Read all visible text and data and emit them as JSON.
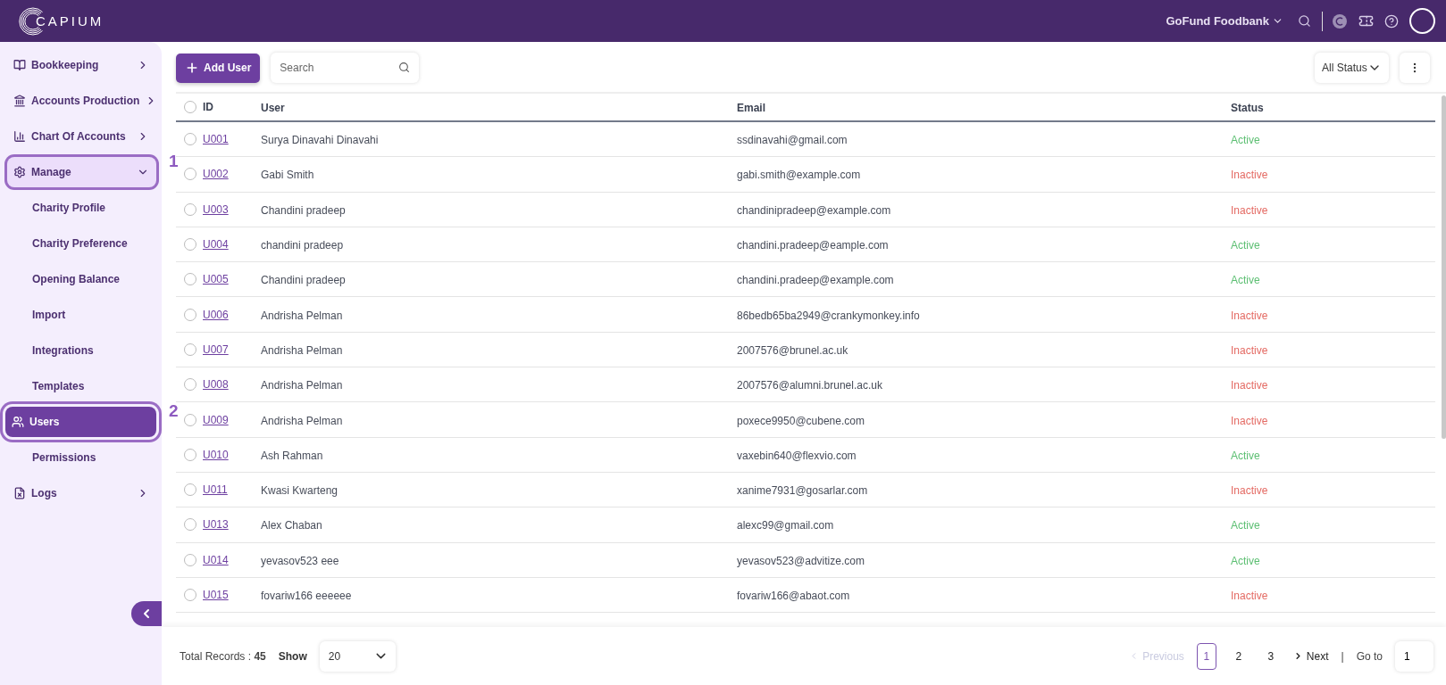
{
  "header": {
    "logo": "CAPIUM",
    "organisation": "GoFund Foodbank"
  },
  "sidebar": {
    "items": [
      {
        "label": "Bookkeeping",
        "expanded": false,
        "selected": false
      },
      {
        "label": "Accounts Production",
        "expanded": false,
        "selected": false
      },
      {
        "label": "Chart Of Accounts",
        "expanded": false,
        "selected": false
      },
      {
        "label": "Manage",
        "expanded": true,
        "selected": false,
        "callout": "1",
        "children": [
          {
            "label": "Charity Profile",
            "selected": false
          },
          {
            "label": "Charity Preference",
            "selected": false
          },
          {
            "label": "Opening Balance",
            "selected": false
          },
          {
            "label": "Import",
            "selected": false
          },
          {
            "label": "Integrations",
            "selected": false
          },
          {
            "label": "Templates",
            "selected": false
          },
          {
            "label": "Users",
            "selected": true,
            "callout": "2"
          },
          {
            "label": "Permissions",
            "selected": false
          }
        ]
      },
      {
        "label": "Logs",
        "expanded": false,
        "selected": false
      }
    ]
  },
  "toolbar": {
    "add_button": "Add User",
    "search": {
      "placeholder": "Search"
    },
    "status_filter": "All Status"
  },
  "table": {
    "columns": [
      "ID",
      "User",
      "Email",
      "Status"
    ],
    "all_checked": false,
    "rows": [
      {
        "id": "U001",
        "user": "Surya Dinavahi Dinavahi",
        "email": "ssdinavahi@gmail.com",
        "status": "Active",
        "active": true,
        "checked": false
      },
      {
        "id": "U002",
        "user": "Gabi Smith",
        "email": "gabi.smith@example.com",
        "status": "Inactive",
        "active": false,
        "checked": false
      },
      {
        "id": "U003",
        "user": "Chandini pradeep",
        "email": "chandinipradeep@example.com",
        "status": "Inactive",
        "active": false,
        "checked": false
      },
      {
        "id": "U004",
        "user": "chandini pradeep",
        "email": "chandini.pradeep@eample.com",
        "status": "Active",
        "active": true,
        "checked": false
      },
      {
        "id": "U005",
        "user": "Chandini pradeep",
        "email": "chandini.pradeep@example.com",
        "status": "Active",
        "active": true,
        "checked": false
      },
      {
        "id": "U006",
        "user": "Andrisha Pelman",
        "email": "86bedb65ba2949@crankymonkey.info",
        "status": "Inactive",
        "active": false,
        "checked": false
      },
      {
        "id": "U007",
        "user": "Andrisha Pelman",
        "email": "2007576@brunel.ac.uk",
        "status": "Inactive",
        "active": false,
        "checked": false
      },
      {
        "id": "U008",
        "user": "Andrisha Pelman",
        "email": "2007576@alumni.brunel.ac.uk",
        "status": "Inactive",
        "active": false,
        "checked": false
      },
      {
        "id": "U009",
        "user": "Andrisha Pelman",
        "email": "poxece9950@cubene.com",
        "status": "Inactive",
        "active": false,
        "checked": false
      },
      {
        "id": "U010",
        "user": "Ash Rahman",
        "email": "vaxebin640@flexvio.com",
        "status": "Active",
        "active": true,
        "checked": false
      },
      {
        "id": "U011",
        "user": "Kwasi Kwarteng",
        "email": "xanime7931@gosarlar.com",
        "status": "Inactive",
        "active": false,
        "checked": false
      },
      {
        "id": "U013",
        "user": "Alex Chaban",
        "email": "alexc99@gmail.com",
        "status": "Active",
        "active": true,
        "checked": false
      },
      {
        "id": "U014",
        "user": "yevasov523 eee",
        "email": "yevasov523@advitize.com",
        "status": "Active",
        "active": true,
        "checked": false
      },
      {
        "id": "U015",
        "user": "fovariw166 eeeeee",
        "email": "fovariw166@abaot.com",
        "status": "Inactive",
        "active": false,
        "checked": false
      }
    ]
  },
  "footer": {
    "total": "Total Records : **45**",
    "show_label": "Show",
    "page_size": "20",
    "previous": {
      "label": "Previous",
      "disabled": true
    },
    "pages": [
      {
        "label": "1",
        "selected": true
      },
      {
        "label": "2",
        "selected": false
      },
      {
        "label": "3",
        "selected": false
      }
    ],
    "next": {
      "label": "Next",
      "disabled": false
    },
    "separator": "|",
    "goto_label": "Go to",
    "goto_value": "1"
  }
}
